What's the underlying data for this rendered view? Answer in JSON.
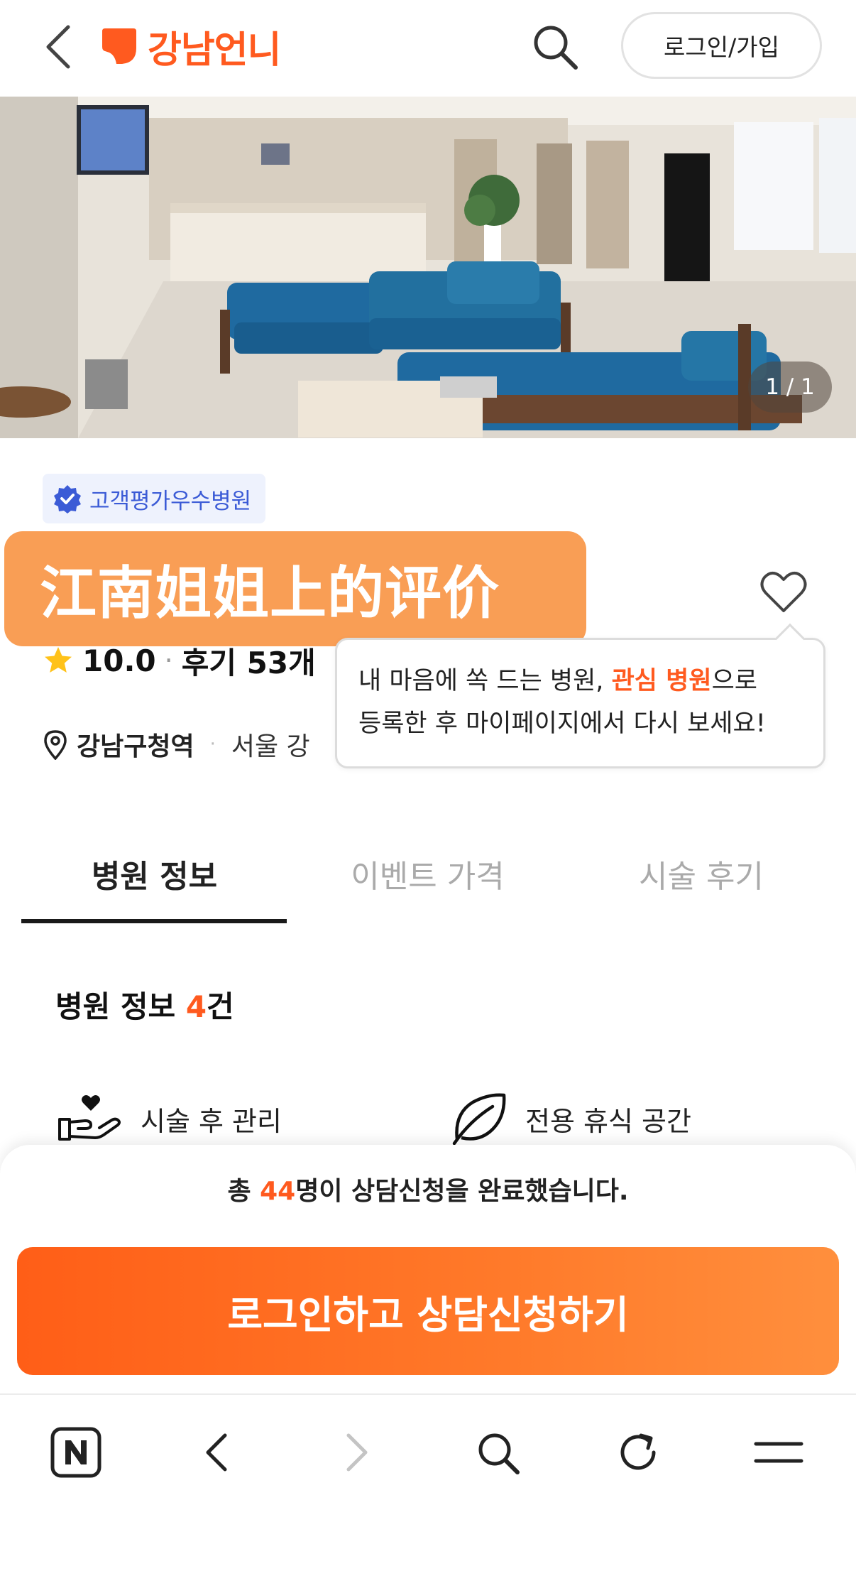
{
  "header": {
    "logo_text": "강남언니",
    "login_label": "로그인/가입"
  },
  "hero": {
    "counter": "1 / 1"
  },
  "badge": {
    "label": "고객평가우수병원"
  },
  "overlay": {
    "text": "江南姐姐上的评价"
  },
  "hospital": {
    "name": "",
    "rating": "10.0",
    "review_count": "후기 53개",
    "station": "강남구청역",
    "address": "서울 강"
  },
  "tooltip": {
    "line1_prefix": "내 마음에 쏙 드는 병원, ",
    "line1_accent": "관심 병원",
    "line1_suffix": "으로",
    "line2": "등록한 후 마이페이지에서 다시 보세요!"
  },
  "tabs": [
    {
      "label": "병원 정보",
      "active": true
    },
    {
      "label": "이벤트 가격",
      "active": false
    },
    {
      "label": "시술 후기",
      "active": false
    }
  ],
  "section": {
    "title": "병원 정보 ",
    "count": "4",
    "unit": "건"
  },
  "features": [
    {
      "label": "시술 후 관리",
      "icon": "hand-heart-icon"
    },
    {
      "label": "전용 휴식 공간",
      "icon": "leaf-icon"
    }
  ],
  "consult": {
    "prefix": "총 ",
    "count": "44",
    "suffix": "명이 상담신청을 완료했습니다."
  },
  "cta": {
    "label": "로그인하고 상담신청하기"
  },
  "colors": {
    "brand": "#ff5a1f",
    "overlay": "#f89646",
    "badge_bg": "#eef2fd",
    "badge_text": "#3b5bd6"
  }
}
